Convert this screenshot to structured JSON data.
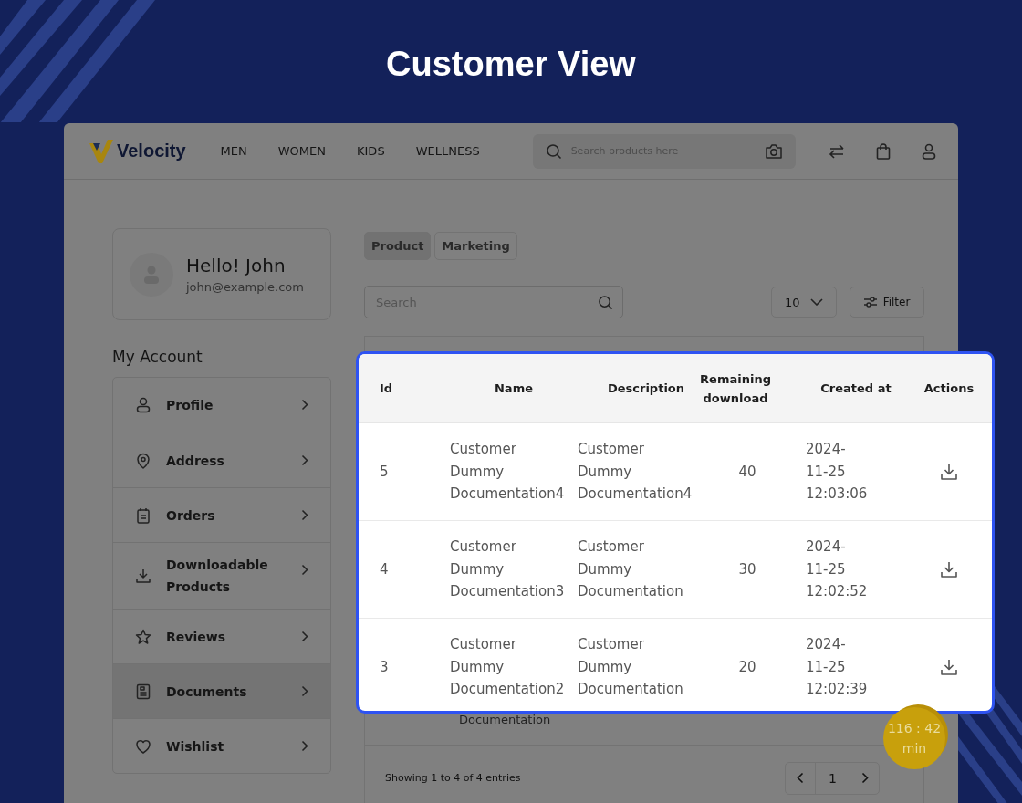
{
  "title": "Customer View",
  "header": {
    "logo": "Velocity",
    "nav": [
      {
        "label": "MEN"
      },
      {
        "label": "WOMEN"
      },
      {
        "label": "KIDS"
      },
      {
        "label": "WELLNESS"
      }
    ],
    "search": {
      "placeholder": "Search products here"
    }
  },
  "profile": {
    "greeting": "Hello! John",
    "email": "john@example.com"
  },
  "account": {
    "heading": "My Account",
    "items": [
      {
        "label": "Profile",
        "kind": "person",
        "selected": false
      },
      {
        "label": "Address",
        "kind": "pin",
        "selected": false
      },
      {
        "label": "Orders",
        "kind": "clipboard",
        "selected": false
      },
      {
        "label": "Downloadable Products",
        "kind": "download",
        "selected": false
      },
      {
        "label": "Reviews",
        "kind": "star",
        "selected": false
      },
      {
        "label": "Documents",
        "kind": "document",
        "selected": true
      },
      {
        "label": "Wishlist",
        "kind": "heart",
        "selected": false
      }
    ]
  },
  "tabs": [
    {
      "label": "Product",
      "selected": true
    },
    {
      "label": "Marketing",
      "selected": false
    }
  ],
  "search": {
    "placeholder": "Search"
  },
  "page_size": "10",
  "filter": "Filter",
  "background_row": {
    "name": "Documentation"
  },
  "footer": {
    "summary": "Showing 1 to 4 of 4 entries",
    "page": "1"
  },
  "popup": {
    "columns": [
      "Id",
      "Name",
      "Description",
      "Remaining download",
      "Created at",
      "Actions"
    ],
    "rows": [
      {
        "id": "5",
        "name": "Customer Dummy Documentation4",
        "description": "Customer Dummy Documentation4",
        "remaining": "40",
        "created_at": "2024-11-25 12:03:06"
      },
      {
        "id": "4",
        "name": "Customer Dummy Documentation3",
        "description": "Customer Dummy Documentation",
        "remaining": "30",
        "created_at": "2024-11-25 12:02:52"
      },
      {
        "id": "3",
        "name": "Customer Dummy Documentation2",
        "description": "Customer Dummy Documentation",
        "remaining": "20",
        "created_at": "2024-11-25 12:02:39"
      }
    ]
  },
  "timer": {
    "time": "116 : 42",
    "unit": "min"
  }
}
